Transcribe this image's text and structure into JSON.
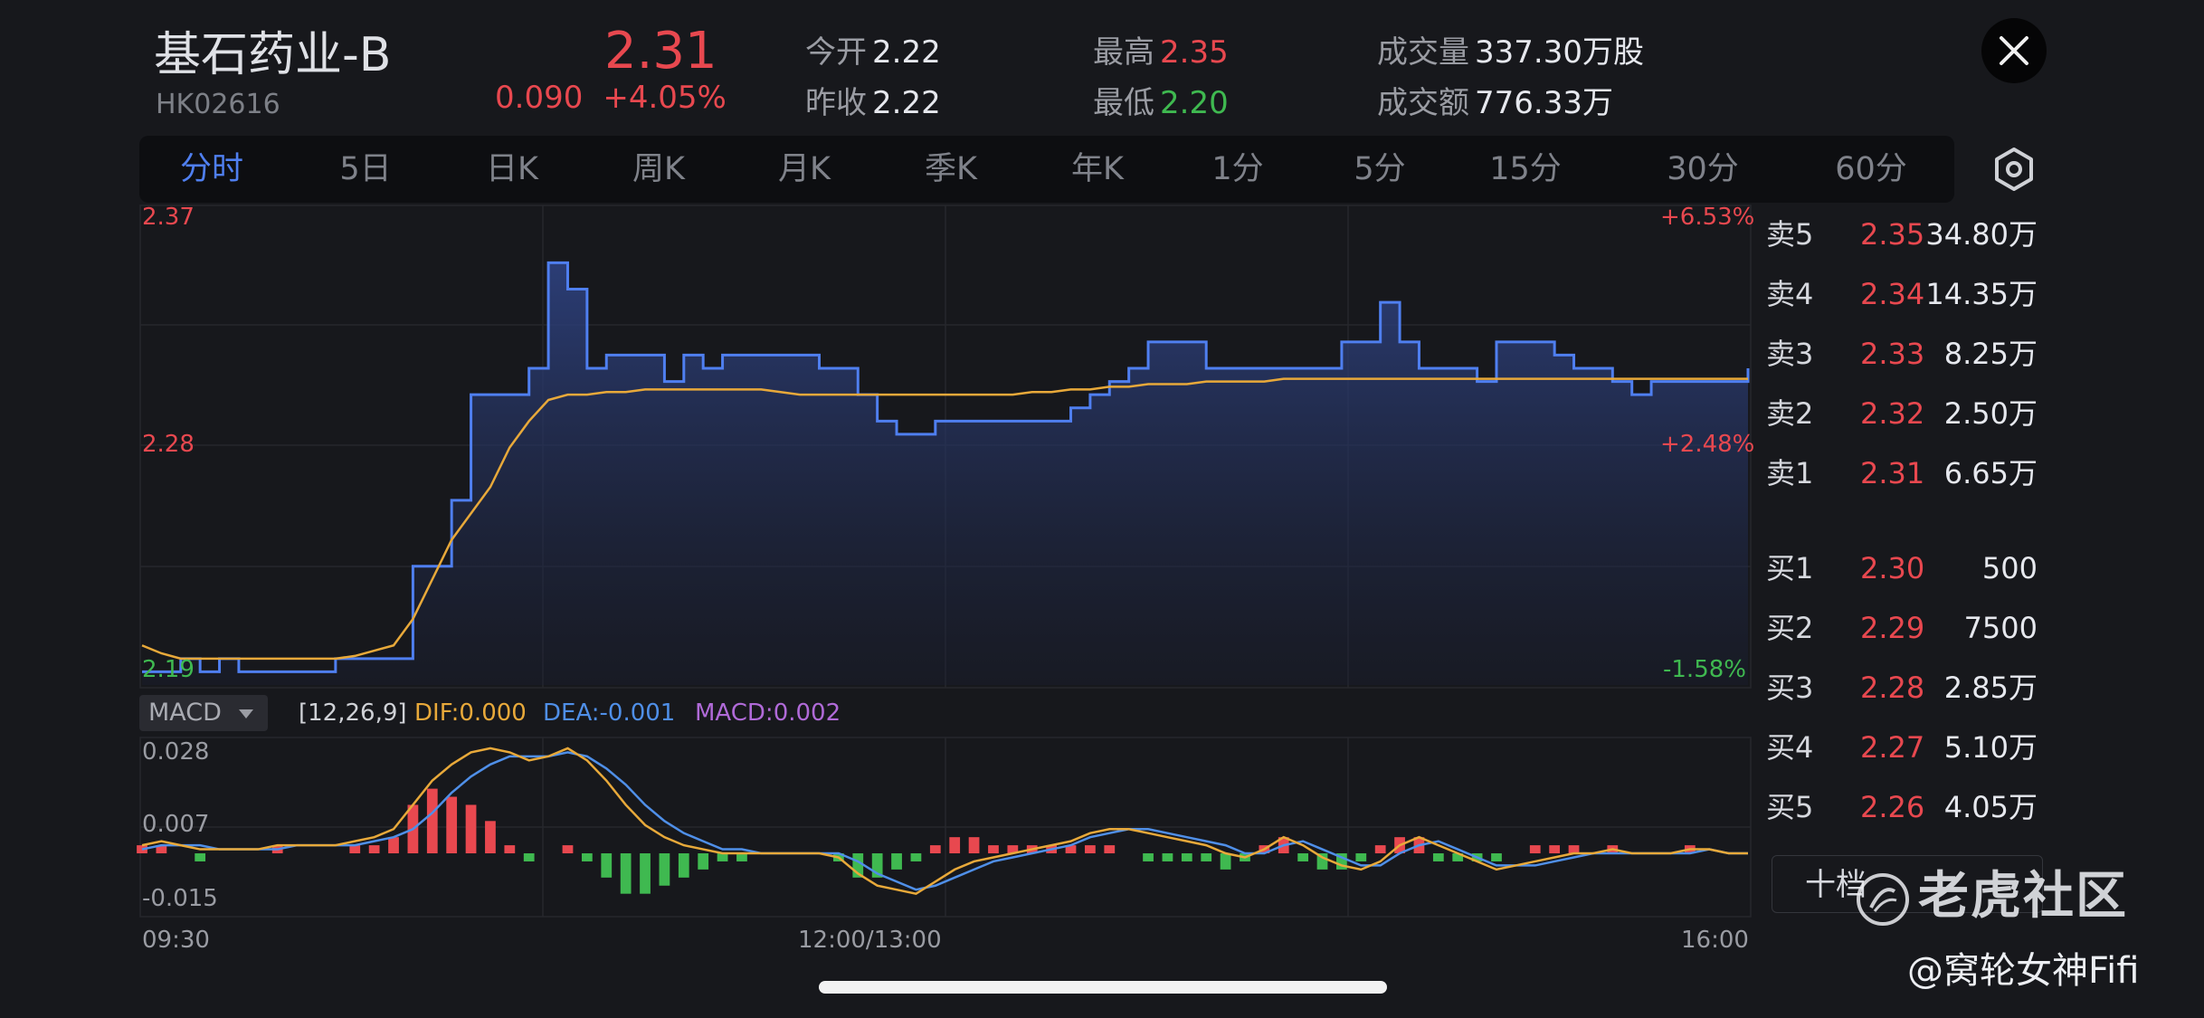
{
  "header": {
    "name": "基石药业-B",
    "code": "HK02616",
    "price": "2.31",
    "change": "0.090",
    "change_pct": "+4.05%",
    "open_label": "今开",
    "open_value": "2.22",
    "prev_close_label": "昨收",
    "prev_close_value": "2.22",
    "high_label": "最高",
    "high_value": "2.35",
    "low_label": "最低",
    "low_value": "2.20",
    "volume_label": "成交量",
    "volume_value": "337.30万股",
    "turnover_label": "成交额",
    "turnover_value": "776.33万"
  },
  "tabs": [
    "分时",
    "5日",
    "日K",
    "周K",
    "月K",
    "季K",
    "年K",
    "1分",
    "5分",
    "15分",
    "30分",
    "60分"
  ],
  "active_tab": 0,
  "price_axis": {
    "top": "2.37",
    "mid": "2.28",
    "bottom": "2.19",
    "pct_top": "+6.53%",
    "pct_mid": "+2.48%",
    "pct_bottom": "-1.58%"
  },
  "macd_axis": {
    "top": "0.028",
    "mid": "0.007",
    "bottom": "-0.015"
  },
  "time_axis": {
    "start": "09:30",
    "mid": "12:00/13:00",
    "end": "16:00"
  },
  "macd_legend": {
    "selector": "MACD",
    "params": "[12,26,9]",
    "dif": "DIF:0.000",
    "dea": "DEA:-0.001",
    "macd": "MACD:0.002"
  },
  "order_book": {
    "asks": [
      {
        "label": "卖5",
        "price": "2.35",
        "volume": "34.80万"
      },
      {
        "label": "卖4",
        "price": "2.34",
        "volume": "14.35万"
      },
      {
        "label": "卖3",
        "price": "2.33",
        "volume": "8.25万"
      },
      {
        "label": "卖2",
        "price": "2.32",
        "volume": "2.50万"
      },
      {
        "label": "卖1",
        "price": "2.31",
        "volume": "6.65万"
      }
    ],
    "bids": [
      {
        "label": "买1",
        "price": "2.30",
        "volume": "500"
      },
      {
        "label": "买2",
        "price": "2.29",
        "volume": "7500"
      },
      {
        "label": "买3",
        "price": "2.28",
        "volume": "2.85万"
      },
      {
        "label": "买4",
        "price": "2.27",
        "volume": "5.10万"
      },
      {
        "label": "买5",
        "price": "2.26",
        "volume": "4.05万"
      }
    ],
    "ten_level_label": "十档"
  },
  "watermark": "老虎社区",
  "credit": "@窝轮女神Fifi",
  "colors": {
    "price_line": "#4f7ff0",
    "avg_line": "#e8a93a",
    "dea_line": "#4f8fe8",
    "up": "#e8484f",
    "down": "#3fb950",
    "macd_legend": "#b06ad8",
    "active_tab": "#4f7ff0"
  },
  "chart_data": [
    {
      "type": "line",
      "title": "",
      "x": [
        0,
        4,
        8,
        12,
        16,
        20,
        24,
        28,
        32,
        36,
        40,
        44,
        48,
        52,
        56,
        60,
        64,
        68,
        72,
        76,
        80,
        84,
        88,
        92,
        96,
        100,
        104,
        108,
        112,
        116,
        120,
        124,
        128,
        132,
        136,
        140,
        144,
        148,
        152,
        156,
        160,
        164,
        168,
        172,
        176,
        180,
        184,
        188,
        192,
        196,
        200,
        204,
        208,
        212,
        216,
        220,
        224,
        228,
        232,
        236,
        240,
        244,
        248,
        252,
        256,
        260,
        264,
        268,
        272,
        276,
        280,
        284,
        288,
        292,
        296,
        300,
        304,
        308,
        312,
        316,
        320,
        324,
        328,
        332
      ],
      "xticks": [
        "09:30",
        "12:00/13:00",
        "16:00"
      ],
      "ylim": [
        2.19,
        2.37
      ],
      "series": [
        {
          "values": [
            2.195,
            2.195,
            2.2,
            2.195,
            2.2,
            2.195,
            2.195,
            2.195,
            2.195,
            2.195,
            2.2,
            2.2,
            2.2,
            2.2,
            2.235,
            2.235,
            2.26,
            2.3,
            2.3,
            2.3,
            2.31,
            2.35,
            2.34,
            2.31,
            2.315,
            2.315,
            2.315,
            2.305,
            2.315,
            2.31,
            2.315,
            2.315,
            2.315,
            2.315,
            2.315,
            2.31,
            2.31,
            2.3,
            2.29,
            2.285,
            2.285,
            2.29,
            2.29,
            2.29,
            2.29,
            2.29,
            2.29,
            2.29,
            2.295,
            2.3,
            2.305,
            2.31,
            2.32,
            2.32,
            2.32,
            2.31,
            2.31,
            2.31,
            2.31,
            2.31,
            2.31,
            2.31,
            2.32,
            2.32,
            2.335,
            2.32,
            2.31,
            2.31,
            2.31,
            2.305,
            2.32,
            2.32,
            2.32,
            2.315,
            2.31,
            2.31,
            2.305,
            2.3,
            2.305,
            2.305,
            2.305,
            2.305,
            2.305,
            2.31
          ]
        },
        {
          "values": [
            2.205,
            2.202,
            2.2,
            2.2,
            2.2,
            2.2,
            2.2,
            2.2,
            2.2,
            2.2,
            2.2,
            2.201,
            2.203,
            2.205,
            2.215,
            2.23,
            2.245,
            2.255,
            2.265,
            2.28,
            2.29,
            2.298,
            2.3,
            2.3,
            2.301,
            2.301,
            2.302,
            2.302,
            2.302,
            2.302,
            2.302,
            2.302,
            2.302,
            2.301,
            2.3,
            2.3,
            2.3,
            2.3,
            2.3,
            2.3,
            2.3,
            2.3,
            2.3,
            2.3,
            2.3,
            2.3,
            2.301,
            2.301,
            2.302,
            2.302,
            2.303,
            2.303,
            2.304,
            2.304,
            2.304,
            2.305,
            2.305,
            2.305,
            2.305,
            2.306,
            2.306,
            2.306,
            2.306,
            2.306,
            2.306,
            2.306,
            2.306,
            2.306,
            2.306,
            2.306,
            2.306,
            2.306,
            2.306,
            2.306,
            2.306,
            2.306,
            2.306,
            2.306,
            2.306,
            2.306,
            2.306,
            2.306,
            2.306,
            2.306
          ]
        }
      ]
    },
    {
      "type": "bar",
      "title": "",
      "ylim": [
        -0.015,
        0.028
      ],
      "series": [
        {
          "name": "DIF",
          "values": [
            0.002,
            0.003,
            0.002,
            0.001,
            0.001,
            0.001,
            0.001,
            0.002,
            0.002,
            0.002,
            0.002,
            0.003,
            0.004,
            0.006,
            0.012,
            0.018,
            0.022,
            0.025,
            0.026,
            0.025,
            0.023,
            0.024,
            0.026,
            0.023,
            0.018,
            0.012,
            0.007,
            0.004,
            0.002,
            0.001,
            0.0,
            0.0,
            0.0,
            0.0,
            0.0,
            0.0,
            -0.001,
            -0.005,
            -0.008,
            -0.009,
            -0.01,
            -0.007,
            -0.004,
            -0.002,
            -0.001,
            0.0,
            0.001,
            0.002,
            0.003,
            0.005,
            0.006,
            0.006,
            0.005,
            0.004,
            0.003,
            0.002,
            0.0,
            -0.001,
            0.001,
            0.004,
            0.002,
            -0.001,
            -0.003,
            -0.004,
            -0.002,
            0.002,
            0.004,
            0.002,
            0.0,
            -0.002,
            -0.004,
            -0.003,
            -0.002,
            -0.001,
            0.0,
            0.0,
            0.001,
            0.0,
            0.0,
            0.0,
            0.001,
            0.001,
            0.0,
            0.0
          ]
        },
        {
          "name": "DEA",
          "values": [
            0.001,
            0.002,
            0.002,
            0.002,
            0.001,
            0.001,
            0.001,
            0.001,
            0.002,
            0.002,
            0.002,
            0.002,
            0.003,
            0.004,
            0.006,
            0.01,
            0.015,
            0.019,
            0.022,
            0.024,
            0.024,
            0.024,
            0.025,
            0.024,
            0.021,
            0.017,
            0.012,
            0.008,
            0.005,
            0.003,
            0.001,
            0.001,
            0.0,
            0.0,
            0.0,
            0.0,
            0.0,
            -0.002,
            -0.005,
            -0.007,
            -0.009,
            -0.008,
            -0.006,
            -0.004,
            -0.002,
            -0.001,
            0.0,
            0.001,
            0.002,
            0.004,
            0.005,
            0.006,
            0.006,
            0.005,
            0.004,
            0.003,
            0.002,
            0.0,
            0.0,
            0.002,
            0.003,
            0.001,
            -0.001,
            -0.003,
            -0.003,
            0.0,
            0.002,
            0.003,
            0.001,
            -0.001,
            -0.003,
            -0.003,
            -0.003,
            -0.002,
            -0.001,
            0.0,
            0.0,
            0.0,
            0.0,
            0.0,
            0.0,
            0.001,
            0.0,
            0.0
          ]
        },
        {
          "name": "MACD",
          "values": [
            0.002,
            0.002,
            0.0,
            -0.002,
            0.0,
            0.0,
            0.0,
            0.002,
            0.0,
            0.0,
            0.0,
            0.002,
            0.002,
            0.004,
            0.012,
            0.016,
            0.014,
            0.012,
            0.008,
            0.002,
            -0.002,
            0.0,
            0.002,
            -0.002,
            -0.006,
            -0.01,
            -0.01,
            -0.008,
            -0.006,
            -0.004,
            -0.002,
            -0.002,
            0.0,
            0.0,
            0.0,
            0.0,
            -0.002,
            -0.006,
            -0.006,
            -0.004,
            -0.002,
            0.002,
            0.004,
            0.004,
            0.002,
            0.002,
            0.002,
            0.002,
            0.002,
            0.002,
            0.002,
            0.0,
            -0.002,
            -0.002,
            -0.002,
            -0.002,
            -0.004,
            -0.002,
            0.002,
            0.004,
            -0.002,
            -0.004,
            -0.004,
            -0.002,
            0.002,
            0.004,
            0.004,
            -0.002,
            -0.002,
            -0.002,
            -0.002,
            0.0,
            0.002,
            0.002,
            0.002,
            0.0,
            0.002,
            0.0,
            0.0,
            0.0,
            0.002,
            0.0,
            0.0,
            0.0
          ]
        }
      ]
    }
  ]
}
